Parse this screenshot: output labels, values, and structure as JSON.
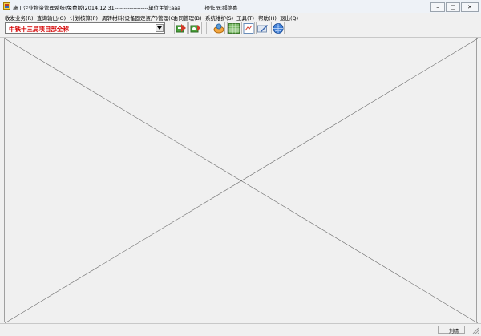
{
  "window": {
    "title_app": "施工企业物资管理系统(免费版)2014.12.31",
    "title_dashes": "------------------",
    "title_unit": "单位主管:aaa",
    "title_operator": "操作员:郝德喜",
    "controls": {
      "minimize": "–",
      "maximize": "□",
      "close": "✕"
    }
  },
  "menu": [
    "收发业务(R)",
    "查询输出(O)",
    "计划核算(P)",
    "周转材料(设备固定资产)管理(C)",
    "合同管理(B)",
    "系统维护(S)",
    "工具(T)",
    "帮助(H)",
    "退出(Q)"
  ],
  "toolbar": {
    "project_selected": "中铁十三局项目部全称",
    "dropdown_icon": "chevron-down-icon",
    "buttons": [
      "stock-in-icon",
      "stock-out-icon",
      "query-icon",
      "spreadsheet-icon",
      "report-icon",
      "edit-icon",
      "globe-icon"
    ]
  },
  "statusbar": {
    "right_text": "刘晴"
  }
}
